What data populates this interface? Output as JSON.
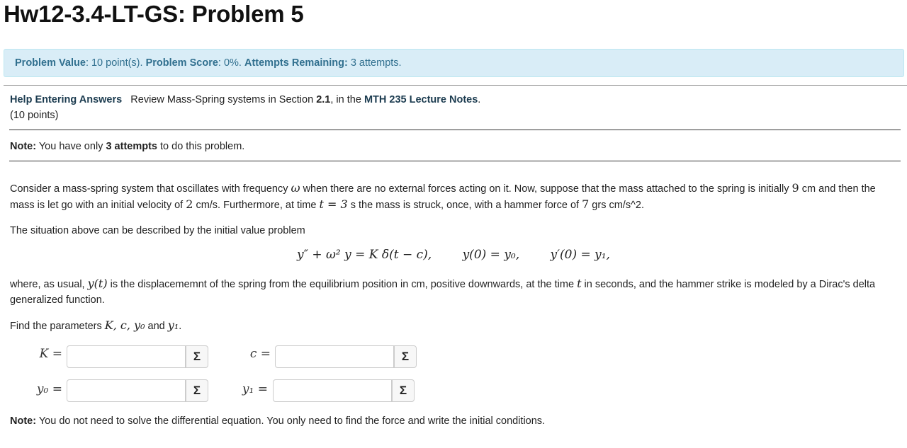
{
  "page": {
    "title": "Hw12-3.4-LT-GS: Problem 5"
  },
  "status": {
    "value_label": "Problem Value",
    "value_text": ": 10 point(s).",
    "score_label": "Problem Score",
    "score_text": ": 0%.",
    "attempts_label": "Attempts Remaining:",
    "attempts_text": "3 attempts."
  },
  "help": {
    "link_label": "Help Entering Answers",
    "review_prefix": "Review Mass-Spring systems in Section",
    "section": "2.1",
    "mid_text": ", in the",
    "notes_link": "MTH 235 Lecture Notes",
    "end": ".",
    "points": "(10 points)"
  },
  "note1": {
    "label": "Note:",
    "prefix": "You have only",
    "attempts": "3 attempts",
    "suffix": "to do this problem."
  },
  "problem": {
    "p1_a": "Consider a mass-spring system that oscillates with frequency",
    "omega": "ω",
    "p1_b": "when there are no external forces acting on it. Now, suppose that the mass attached to the spring is initially",
    "init_pos": "9",
    "p1_c": "cm and then the mass is let go with an initial velocity of",
    "init_vel": "2",
    "p1_d": "cm/s. Furthermore, at time",
    "t_eq": "t = 3",
    "p1_e": "s the mass is struck, once, with a hammer force of",
    "force": "7",
    "p1_f": "grs cm/s^2.",
    "p2": "The situation above can be described by the initial value problem",
    "eq1": "y″ + ω² y = K δ(t − c),",
    "eq2": "y(0) = y₀,",
    "eq3": "y′(0) = y₁,",
    "p3_a": "where, as usual,",
    "yt": "y(t)",
    "p3_b": "is the displacememnt of the spring from the equilibrium position in cm, positive downwards, at the time",
    "t": "t",
    "p3_c": "in seconds, and the hammer strike is modeled by a Dirac's delta generalized function.",
    "p4_a": "Find the parameters",
    "params": "K, c, y₀",
    "p4_and": "and",
    "y1": "y₁",
    "p4_end": "."
  },
  "answers": {
    "K_label": "K =",
    "c_label": "c =",
    "y0_label": "y₀ =",
    "y1_label": "y₁ =",
    "K_value": "",
    "c_value": "",
    "y0_value": "",
    "y1_value": "",
    "sigma": "Σ"
  },
  "note2": {
    "label": "Note:",
    "text": "You do not need to solve the differential equation. You only need to find the force and write the initial conditions."
  }
}
